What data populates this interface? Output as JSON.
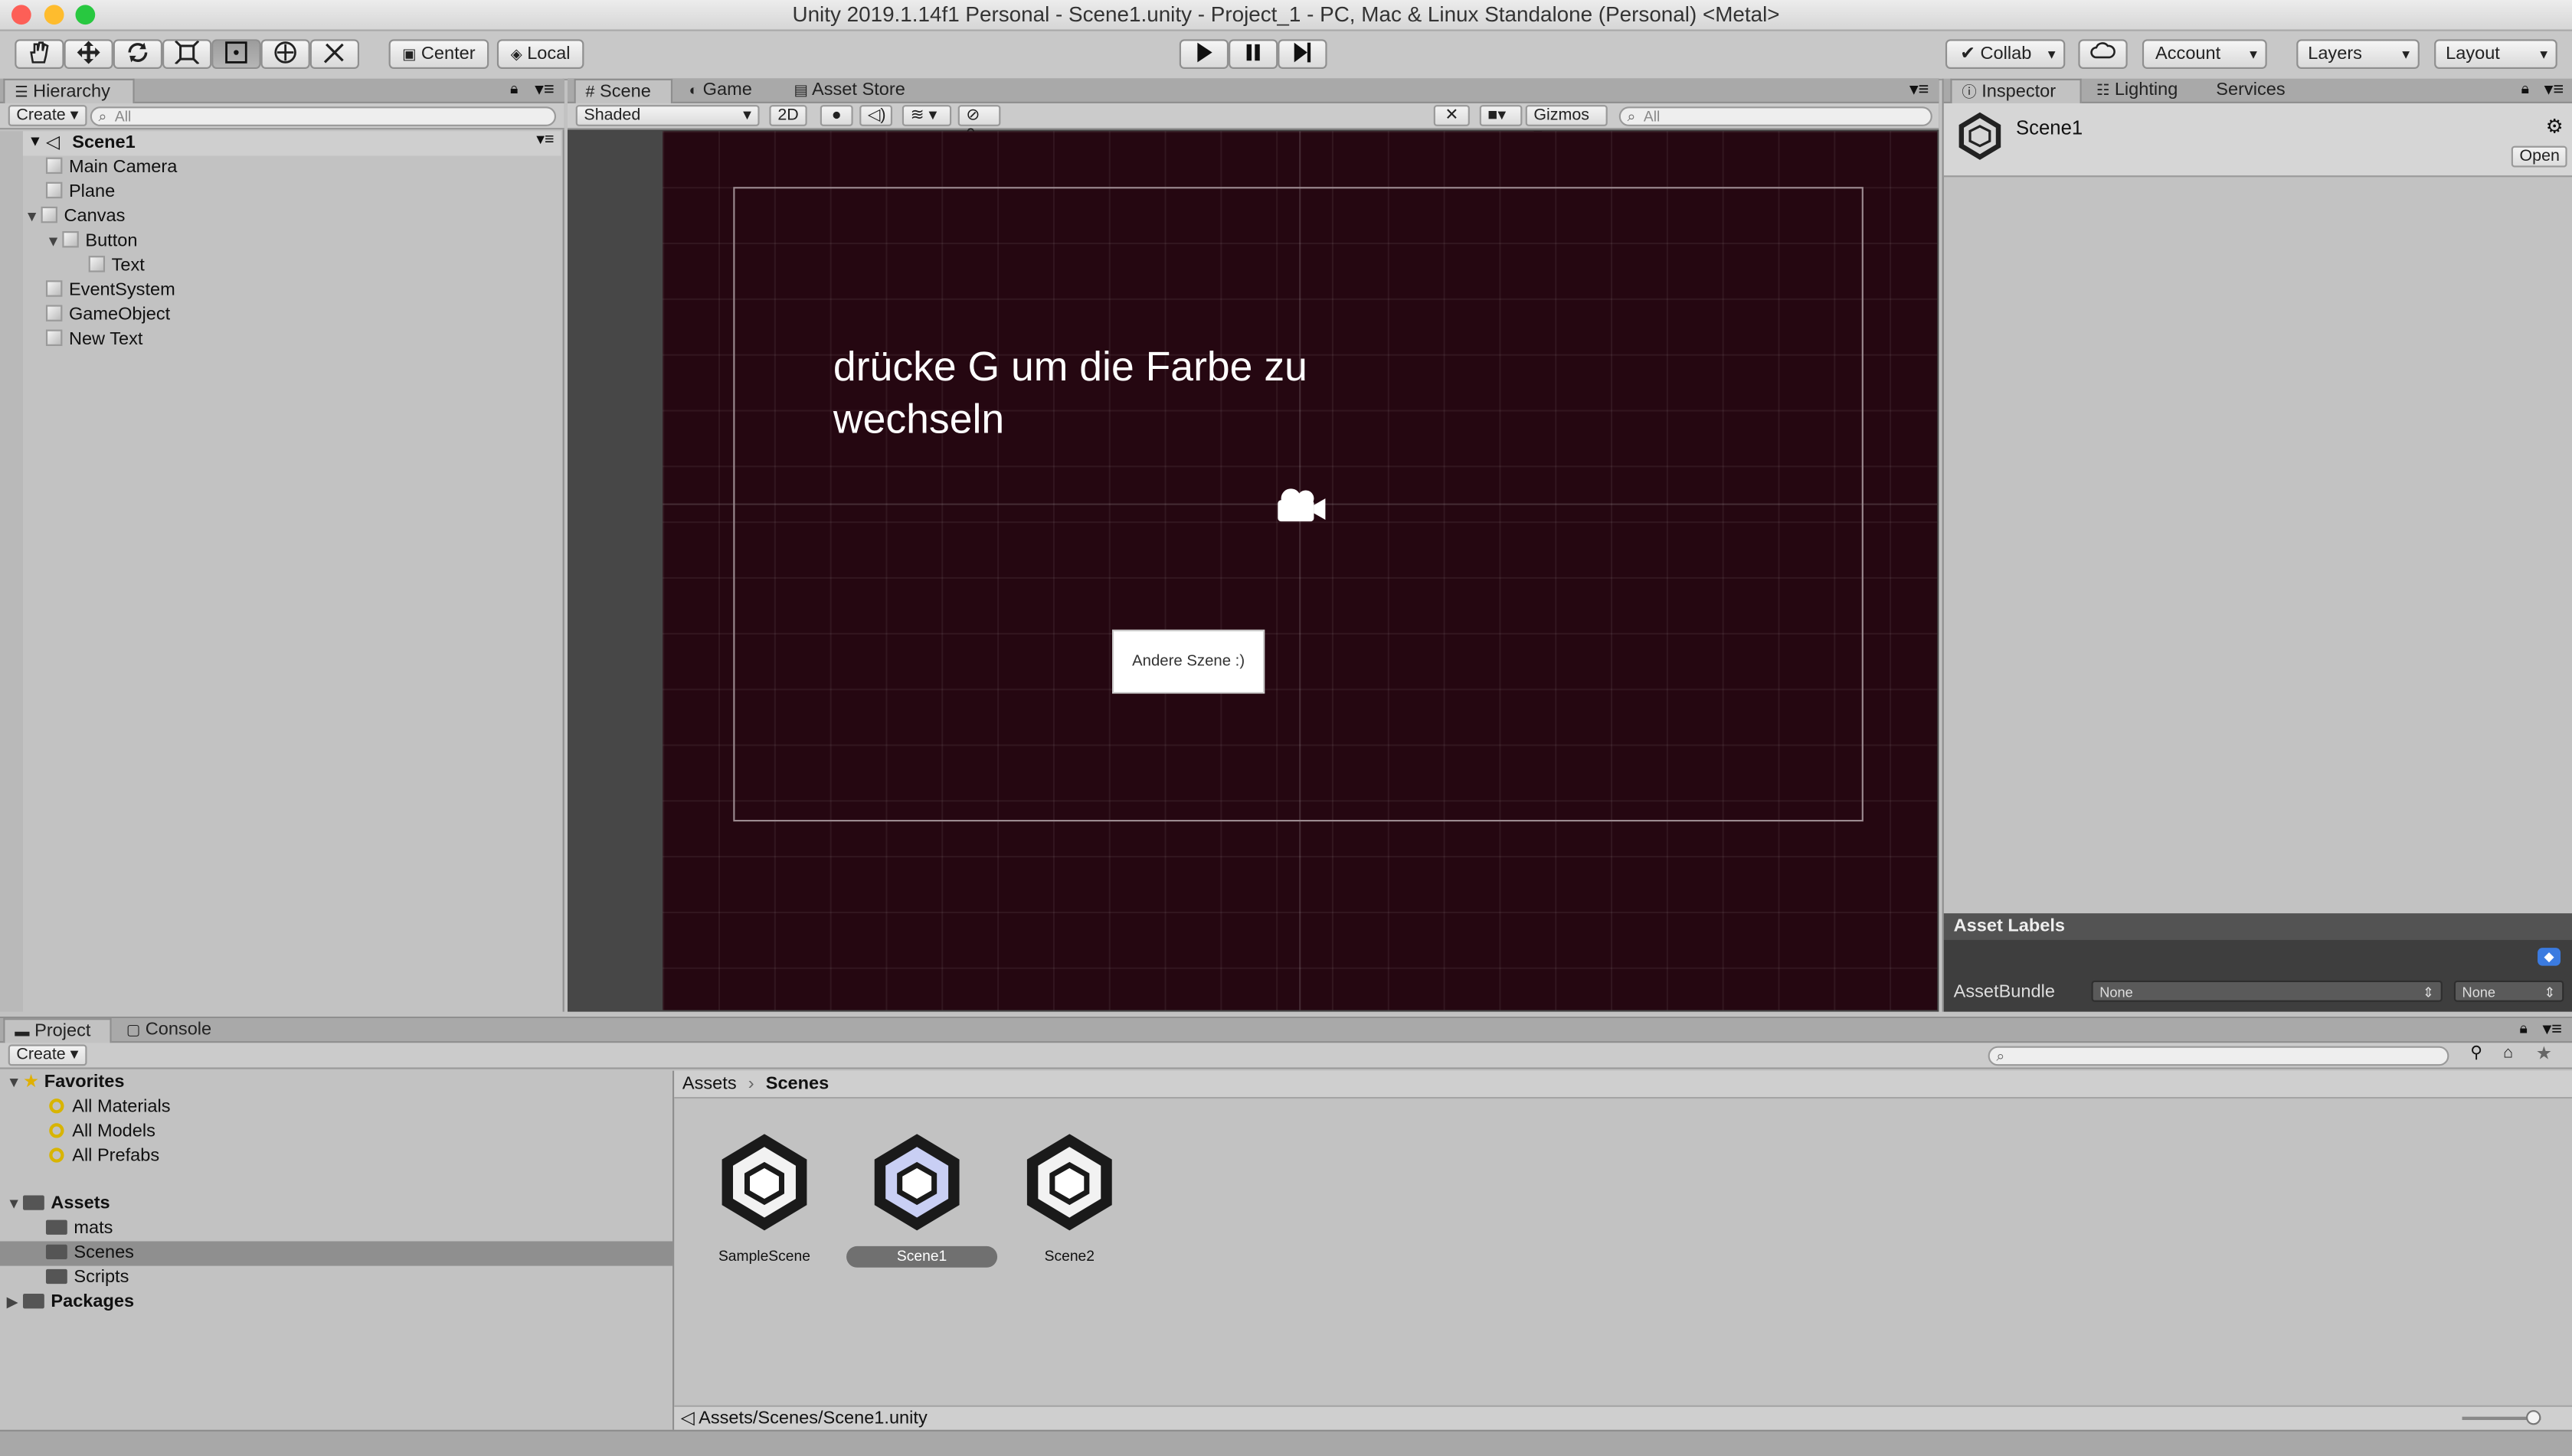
{
  "window": {
    "title": "Unity 2019.1.14f1 Personal - Scene1.unity - Project_1 - PC, Mac & Linux Standalone (Personal) <Metal>"
  },
  "toolbar": {
    "tools": [
      "hand-icon",
      "move-icon",
      "rotate-icon",
      "scale-icon",
      "rect-transform-icon",
      "transform-icon",
      "custom-tool-icon"
    ],
    "pivot_label": "Center",
    "space_label": "Local",
    "collab_label": "Collab",
    "account_label": "Account",
    "layers_label": "Layers",
    "layout_label": "Layout"
  },
  "hierarchy": {
    "tab_label": "Hierarchy",
    "create_label": "Create",
    "search_placeholder": "All",
    "scene_name": "Scene1",
    "items": [
      {
        "label": "Main Camera",
        "depth": 1,
        "expand": ""
      },
      {
        "label": "Plane",
        "depth": 1,
        "expand": ""
      },
      {
        "label": "Canvas",
        "depth": 1,
        "expand": "▼"
      },
      {
        "label": "Button",
        "depth": 2,
        "expand": "▼"
      },
      {
        "label": "Text",
        "depth": 3,
        "expand": ""
      },
      {
        "label": "EventSystem",
        "depth": 1,
        "expand": ""
      },
      {
        "label": "GameObject",
        "depth": 1,
        "expand": ""
      },
      {
        "label": "New Text",
        "depth": 1,
        "expand": ""
      }
    ]
  },
  "scene": {
    "tabs": [
      "Scene",
      "Game",
      "Asset Store"
    ],
    "shading_mode": "Shaded",
    "mode_2d": "2D",
    "hidden_count": "0",
    "gizmos_label": "Gizmos",
    "search_placeholder": "All",
    "canvas_text": "drücke G um die Farbe zu wechseln",
    "button_text": "Andere Szene :)",
    "background_color": "#250711"
  },
  "inspector": {
    "tabs": [
      "Inspector",
      "Lighting",
      "Services"
    ],
    "asset_name": "Scene1",
    "open_label": "Open",
    "asset_labels_title": "Asset Labels",
    "assetbundle_label": "AssetBundle",
    "assetbundle_value": "None",
    "variant_value": "None"
  },
  "project": {
    "tabs": [
      "Project",
      "Console"
    ],
    "create_label": "Create",
    "favorites_label": "Favorites",
    "favorites": [
      "All Materials",
      "All Models",
      "All Prefabs"
    ],
    "assets_label": "Assets",
    "asset_folders": [
      "mats",
      "Scenes",
      "Scripts"
    ],
    "packages_label": "Packages",
    "breadcrumb": [
      "Assets",
      "Scenes"
    ],
    "files": [
      "SampleScene",
      "Scene1",
      "Scene2"
    ],
    "selected_path": "Assets/Scenes/Scene1.unity"
  }
}
